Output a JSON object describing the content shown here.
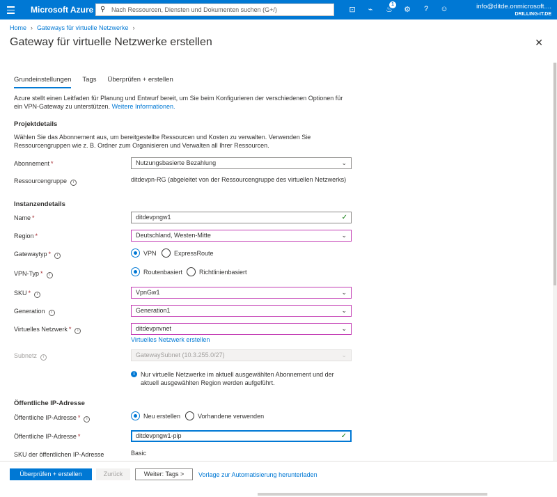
{
  "topbar": {
    "brand": "Microsoft Azure",
    "search_placeholder": "Nach Ressourcen, Diensten und Dokumenten suchen (G+/)",
    "notification_count": "1",
    "account_email": "info@ditde.onmicrosoft....",
    "account_tenant": "DRILLING-IT.DE",
    "icons": [
      "terminal-icon",
      "feedback-filter-icon",
      "bell-icon",
      "gear-icon",
      "help-icon",
      "smiley-icon"
    ]
  },
  "breadcrumb": {
    "home": "Home",
    "parent": "Gateways für virtuelle Netzwerke"
  },
  "page": {
    "title": "Gateway für virtuelle Netzwerke erstellen"
  },
  "tabs": {
    "basics": "Grundeinstellungen",
    "tags": "Tags",
    "review": "Überprüfen + erstellen"
  },
  "intro": {
    "text": "Azure stellt einen Leitfaden für Planung und Entwurf bereit, um Sie beim Konfigurieren der verschiedenen Optionen für ein VPN-Gateway zu unterstützen.",
    "link": "Weitere Informationen."
  },
  "project": {
    "heading": "Projektdetails",
    "desc": "Wählen Sie das Abonnement aus, um bereitgestellte Ressourcen und Kosten zu verwalten. Verwenden Sie Ressourcengruppen wie z. B. Ordner zum Organisieren und Verwalten all Ihrer Ressourcen.",
    "subscription_label": "Abonnement",
    "subscription_value": "Nutzungsbasierte Bezahlung",
    "rg_label": "Ressourcengruppe",
    "rg_value": "ditdevpn-RG (abgeleitet von der Ressourcengruppe des virtuellen Netzwerks)"
  },
  "instance": {
    "heading": "Instanzendetails",
    "name_label": "Name",
    "name_value": "ditdevpngw1",
    "region_label": "Region",
    "region_value": "Deutschland, Westen-Mitte",
    "gwtype_label": "Gatewaytyp",
    "gwtype_opt1": "VPN",
    "gwtype_opt2": "ExpressRoute",
    "vpntype_label": "VPN-Typ",
    "vpntype_opt1": "Routenbasiert",
    "vpntype_opt2": "Richtlinienbasiert",
    "sku_label": "SKU",
    "sku_value": "VpnGw1",
    "gen_label": "Generation",
    "gen_value": "Generation1",
    "vnet_label": "Virtuelles Netzwerk",
    "vnet_value": "ditdevpnvnet",
    "vnet_create_link": "Virtuelles Netzwerk erstellen",
    "subnet_label": "Subnetz",
    "subnet_value": "GatewaySubnet (10.3.255.0/27)",
    "subnet_note": "Nur virtuelle Netzwerke im aktuell ausgewählten Abonnement und der aktuell ausgewählten Region werden aufgeführt."
  },
  "publicip": {
    "heading": "Öffentliche IP-Adresse",
    "mode_label": "Öffentliche IP-Adresse",
    "mode_opt1": "Neu erstellen",
    "mode_opt2": "Vorhandene verwenden",
    "name_label": "Öffentliche IP-Adresse",
    "name_value": "ditdevpngw1-pip",
    "sku_label": "SKU der öffentlichen IP-Adresse",
    "sku_value": "Basic"
  },
  "footer": {
    "review_create": "Überprüfen + erstellen",
    "back": "Zurück",
    "next": "Weiter: Tags >",
    "download": "Vorlage zur Automatisierung herunterladen"
  },
  "colors": {
    "accent": "#0078d4",
    "required": "#a4262c",
    "valid": "#107c10",
    "invalid_border": "#c239b3"
  }
}
